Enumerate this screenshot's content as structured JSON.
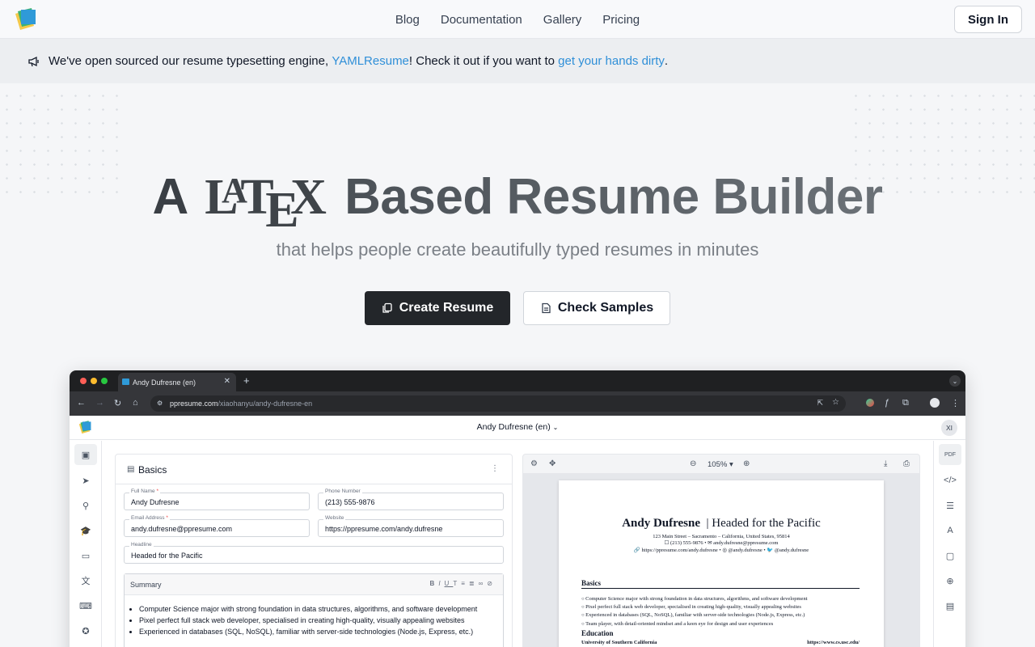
{
  "nav": {
    "links": [
      "Blog",
      "Documentation",
      "Gallery",
      "Pricing"
    ],
    "signin": "Sign In"
  },
  "banner": {
    "text_before": "We've open sourced our resume typesetting engine, ",
    "link1": "YAMLResume",
    "text_middle": "! Check it out if you want to ",
    "link2": "get your hands dirty",
    "text_after": "."
  },
  "hero": {
    "title_prefix": "A",
    "latex_l": "L",
    "latex_a": "A",
    "latex_t": "T",
    "latex_e": "E",
    "latex_x": "X",
    "title_rest": "Based Resume Builder",
    "subtitle": "that helps people create beautifully typed resumes in minutes",
    "primary_btn": "Create Resume",
    "secondary_btn": "Check Samples"
  },
  "browser": {
    "tab_title": "Andy Dufresne (en)",
    "url_host": "ppresume.com",
    "url_path": "/xiaohanyu/andy-dufresne-en",
    "app_title": "Andy Dufresne (en)",
    "avatar": "XI"
  },
  "editor": {
    "section": "Basics",
    "fields": [
      {
        "label": "Full Name",
        "value": "Andy Dufresne",
        "required": true
      },
      {
        "label": "Phone Number",
        "value": "(213) 555-9876",
        "required": false
      },
      {
        "label": "Email Address",
        "value": "andy.dufresne@ppresume.com",
        "required": true
      },
      {
        "label": "Website",
        "value": "https://ppresume.com/andy.dufresne",
        "required": false
      },
      {
        "label": "Headline",
        "value": "Headed for the Pacific",
        "required": false
      }
    ],
    "summary_label": "Summary",
    "summary_items": [
      "Computer Science major with strong foundation in data structures, algorithms, and software development",
      "Pixel perfect full stack web developer, specialised in creating high-quality, visually appealing websites",
      "Experienced in databases (SQL, NoSQL), familiar with server-side technologies (Node.js, Express, etc.)"
    ]
  },
  "preview": {
    "zoom": "105%",
    "name": "Andy Dufresne",
    "headline": "| Headed for the Pacific",
    "address": "123 Main Street – Sacramento – California, United States, 95814",
    "contacts": "☐ (213) 555-9876   •   ✉ andy.dufresne@ppresume.com",
    "links": "🔗 https://ppresume.com/andy.dufresne   •   ◎ @andy.dufresne   •   🐦 @andy.dufresne",
    "basics_title": "Basics",
    "basics_items": [
      "Computer Science major with strong foundation in data structures, algorithms, and software development",
      "Pixel perfect full stack web developer, specialised in creating high-quality, visually appealing websites",
      "Experienced in databases (SQL, NoSQL), familiar with server-side technologies (Node.js, Express, etc.)",
      "Team player, with detail-oriented mindset and a keen eye for design and user experiences"
    ],
    "education_title": "Education",
    "school": "University of Southern California",
    "school_url": "https://www.cs.usc.edu/"
  },
  "colors": {
    "link": "#2f8fd8",
    "primary_button": "#23262a"
  }
}
